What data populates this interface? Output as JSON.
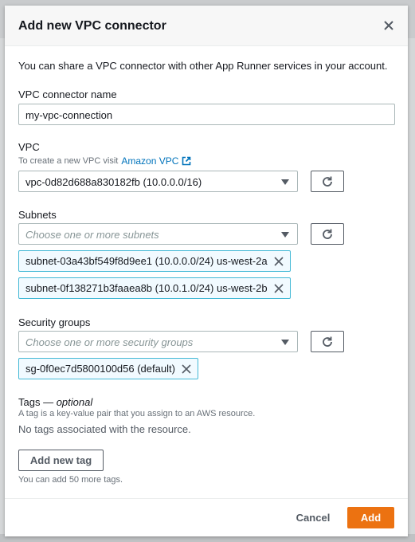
{
  "modal": {
    "title": "Add new VPC connector",
    "description": "You can share a VPC connector with other App Runner services in your account.",
    "name_field": {
      "label": "VPC connector name",
      "value": "my-vpc-connection"
    },
    "vpc": {
      "label": "VPC",
      "help_prefix": "To create a new VPC visit",
      "help_link": "Amazon VPC",
      "selected": "vpc-0d82d688a830182fb (10.0.0.0/16)"
    },
    "subnets": {
      "label": "Subnets",
      "placeholder": "Choose one or more subnets",
      "tokens": [
        "subnet-03a43bf549f8d9ee1 (10.0.0.0/24) us-west-2a",
        "subnet-0f138271b3faaea8b (10.0.1.0/24) us-west-2b"
      ]
    },
    "security_groups": {
      "label": "Security groups",
      "placeholder": "Choose one or more security groups",
      "tokens": [
        "sg-0f0ec7d5800100d56 (default)"
      ]
    },
    "tags": {
      "label": "Tags —",
      "optional": "optional",
      "help": "A tag is a key-value pair that you assign to an AWS resource.",
      "empty": "No tags associated with the resource.",
      "add_button": "Add new tag",
      "limit": "You can add 50 more tags."
    },
    "footer": {
      "cancel": "Cancel",
      "add": "Add"
    },
    "colors": {
      "primary": "#ec7211",
      "link": "#0073bb",
      "token_border": "#44b9d6"
    }
  }
}
